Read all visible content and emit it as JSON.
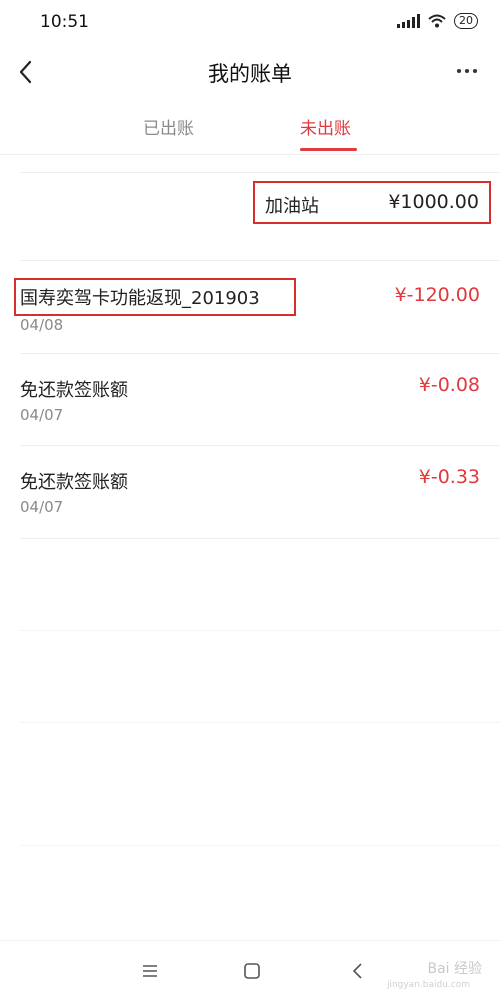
{
  "status_bar": {
    "time": "10:51",
    "battery": "20"
  },
  "header": {
    "title": "我的账单"
  },
  "tabs": [
    {
      "label": "已出账",
      "active": false
    },
    {
      "label": "未出账",
      "active": true
    }
  ],
  "highlight_entry": {
    "name": "加油站",
    "amount": "¥1000.00"
  },
  "transactions": [
    {
      "name": "国寿奕驾卡功能返现_201903",
      "date": "04/08",
      "amount": "¥-120.00"
    },
    {
      "name": "免还款签账额",
      "date": "04/07",
      "amount": "¥-0.08"
    },
    {
      "name": "免还款签账额",
      "date": "04/07",
      "amount": "¥-0.33"
    }
  ],
  "watermark": {
    "text": "Bai 经验",
    "sub": "jingyan.baidu.com"
  },
  "colors": {
    "accent": "#e0393e",
    "highlight_box": "#d62d2d"
  }
}
